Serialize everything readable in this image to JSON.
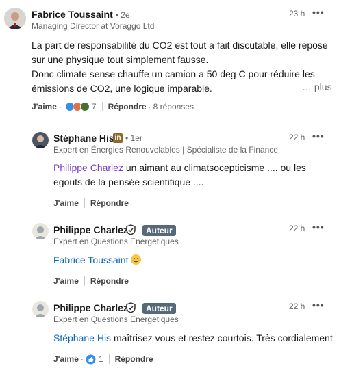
{
  "main_comment": {
    "author": "Fabrice Toussaint",
    "degree": "• 2e",
    "headline": "Managing Director at Voraggo Ltd",
    "time": "23 h",
    "text_line1": "La part de responsabilité du CO2 est tout a fait discutable, elle repose",
    "text_line2": "sur une physique tout simplement fausse.",
    "text_line3": "Donc climate sense chauffe un camion a 50 deg C pour réduire les",
    "text_line4": "émissions de CO2, une logique imparable.",
    "more": "… plus",
    "like_label": "J'aime",
    "reaction_count": "7",
    "reply_label": "Répondre",
    "replies_count": "8 réponses"
  },
  "replies": [
    {
      "author": "Stéphane His",
      "degree": "• 1er",
      "headline": "Expert en Énergies Renouvelables | Spécialiste de la Finance ...",
      "time": "22 h",
      "mention": "Philippe Charlez",
      "text": " un aimant au climatsocepticisme .... ou les",
      "text_line2": "egouts de la pensée scientifique ....",
      "like_label": "J'aime",
      "reply_label": "Répondre"
    },
    {
      "author": "Philippe Charlez",
      "badge": "Auteur",
      "headline": "Expert en Questions Energétiques",
      "time": "22 h",
      "mention": "Fabrice Toussaint",
      "like_label": "J'aime",
      "reply_label": "Répondre"
    },
    {
      "author": "Philippe Charlez",
      "badge": "Auteur",
      "headline": "Expert en Questions Energétiques",
      "time": "22 h",
      "mention": "Stéphane His",
      "text": " maîtrisez vous et restez courtois. Très cordialement",
      "like_label": "J'aime",
      "reaction_count": "1",
      "reply_label": "Répondre"
    }
  ],
  "icons": {
    "more": "•••",
    "linkedin_badge": "in",
    "verified": "shield-check-icon"
  },
  "colors": {
    "link_blue": "#0a66c2",
    "mention_purple": "#7b3fc4",
    "author_badge": "#56687a"
  }
}
